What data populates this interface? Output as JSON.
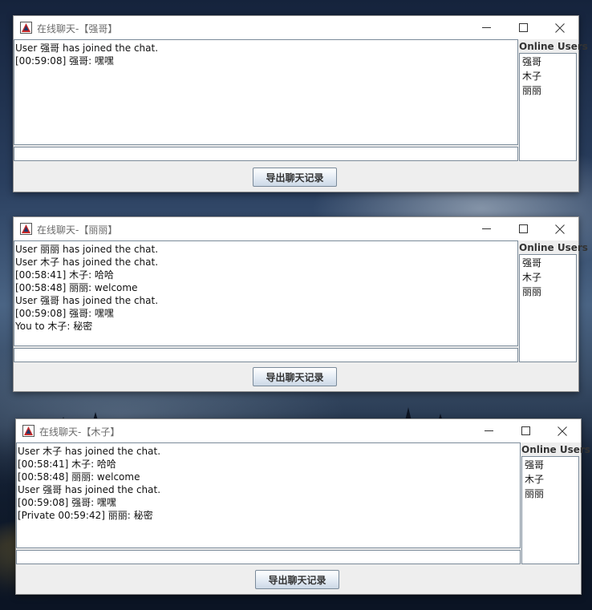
{
  "windows": [
    {
      "title": "在线聊天-【强哥】",
      "messages": [
        "User 强哥 has joined the chat.",
        "[00:59:08] 强哥: 嘿嘿"
      ],
      "input_value": "",
      "users_label": "Online Users",
      "users": [
        "强哥",
        "木子",
        "丽丽"
      ],
      "export_label": "导出聊天记录"
    },
    {
      "title": "在线聊天-【丽丽】",
      "messages": [
        "User 丽丽 has joined the chat.",
        "User 木子 has joined the chat.",
        "[00:58:41] 木子: 哈哈",
        "[00:58:48] 丽丽: welcome",
        "User 强哥 has joined the chat.",
        "[00:59:08] 强哥: 嘿嘿",
        "You to 木子: 秘密"
      ],
      "input_value": "",
      "users_label": "Online Users",
      "users": [
        "强哥",
        "木子",
        "丽丽"
      ],
      "export_label": "导出聊天记录"
    },
    {
      "title": "在线聊天-【木子】",
      "messages": [
        "User 木子 has joined the chat.",
        "[00:58:41] 木子: 哈哈",
        "[00:58:48] 丽丽: welcome",
        "User 强哥 has joined the chat.",
        "[00:59:08] 强哥: 嘿嘿",
        "[Private 00:59:42] 丽丽: 秘密"
      ],
      "input_value": "",
      "users_label": "Online Users",
      "users": [
        "强哥",
        "木子",
        "丽丽"
      ],
      "export_label": "导出聊天记录"
    }
  ]
}
